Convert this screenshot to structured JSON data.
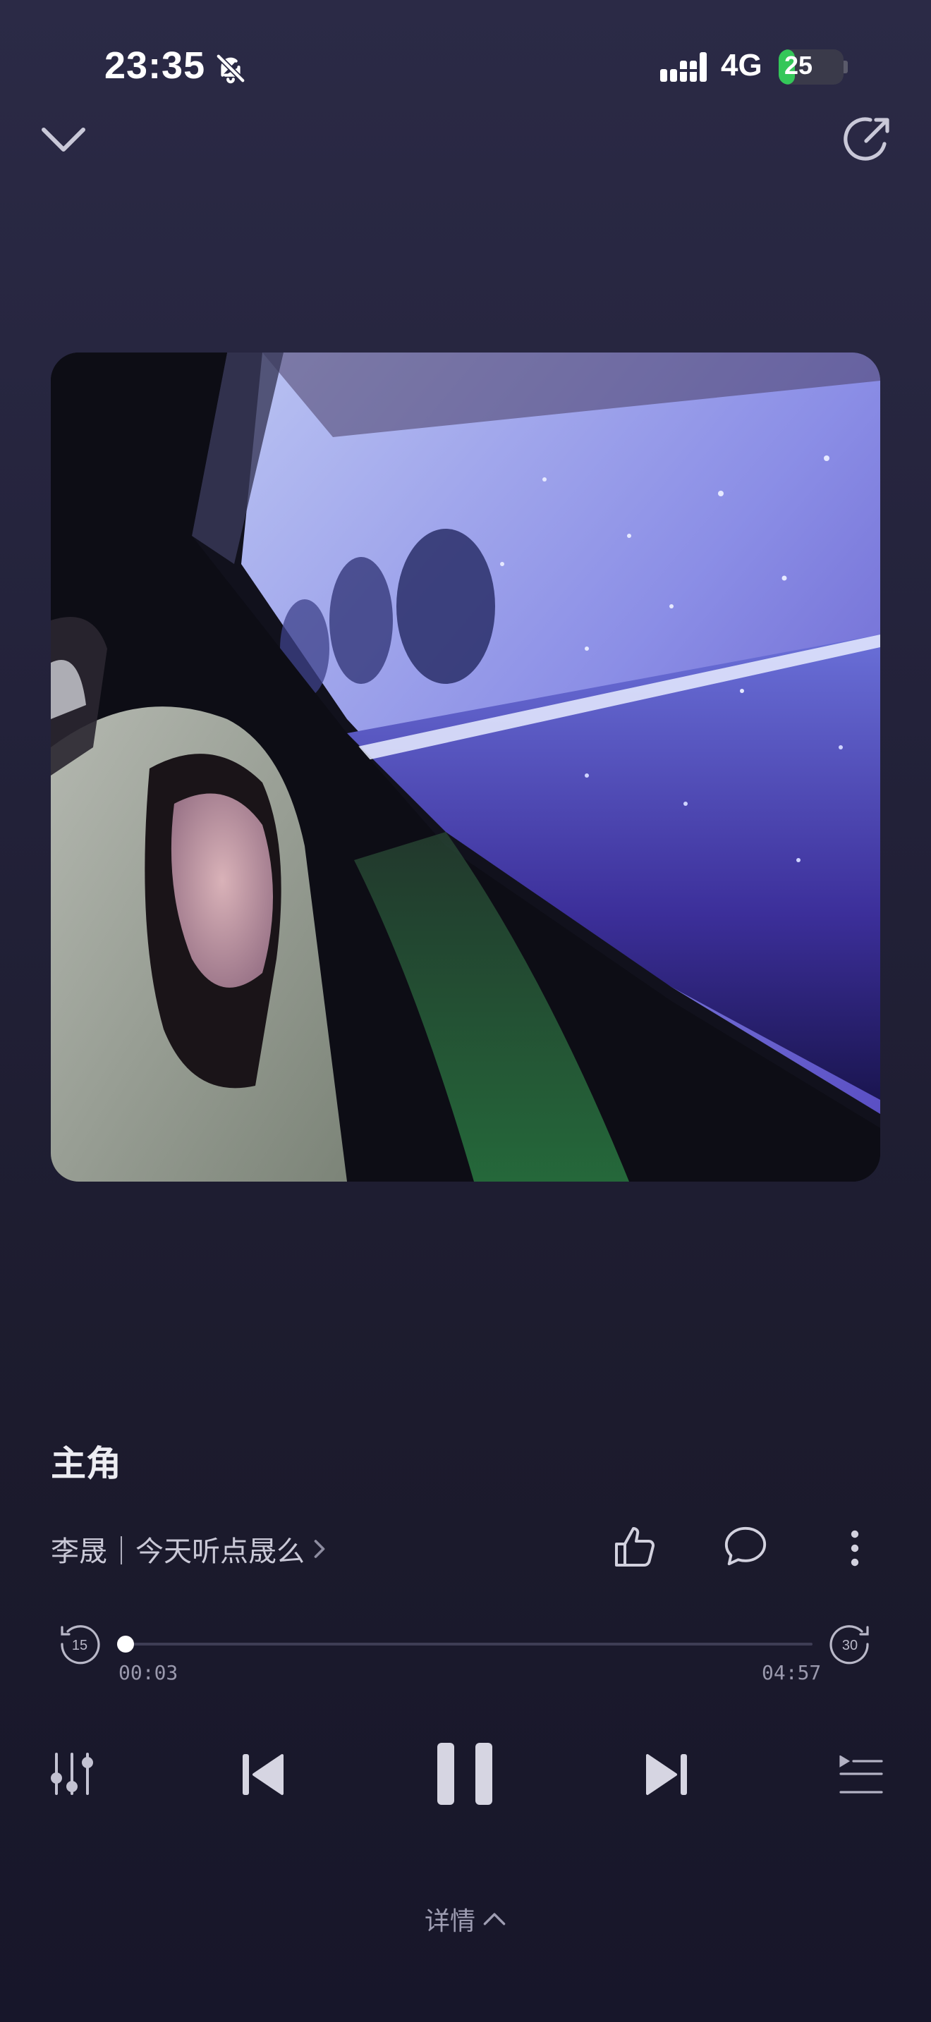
{
  "status_bar": {
    "time": "23:35",
    "network": "4G",
    "battery_level": "25",
    "battery_fraction": 0.25,
    "icons": [
      "bell-muted-icon",
      "signal-icon",
      "battery-icon"
    ]
  },
  "header": {
    "icons": [
      "chevron-down-icon",
      "share-icon"
    ]
  },
  "album": {
    "icon": "album-cover-image"
  },
  "song": {
    "title": "主角",
    "artist_album": "李晟｜今天听点晟么"
  },
  "actions": {
    "icons": [
      "thumbs-up-icon",
      "comment-icon",
      "more-vertical-icon"
    ]
  },
  "progress": {
    "current": "00:03",
    "total": "04:57",
    "fraction": 0.01,
    "rewind_label": "15",
    "forward_label": "30"
  },
  "controls": {
    "icons": [
      "equalizer-icon",
      "previous-icon",
      "pause-icon",
      "next-icon",
      "queue-icon"
    ]
  },
  "details": {
    "label": "详情"
  },
  "colors": {
    "bg_top": "#2b2a46",
    "bg_bottom": "#17162a",
    "battery": "#34c759",
    "text_primary": "#ececf2",
    "text_secondary": "#9e9db2"
  }
}
